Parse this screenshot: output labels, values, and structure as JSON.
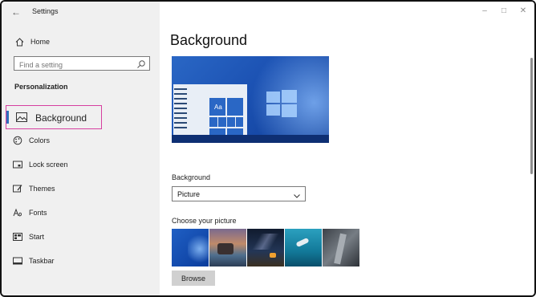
{
  "window": {
    "title": "Settings",
    "controls": [
      "minimize",
      "maximize",
      "close"
    ]
  },
  "sidebar": {
    "home_label": "Home",
    "search": {
      "placeholder": "Find a setting",
      "icon": "search-icon"
    },
    "section_title": "Personalization",
    "items": [
      {
        "label": "Background",
        "icon": "image-icon",
        "active": true
      },
      {
        "label": "Colors",
        "icon": "palette-icon"
      },
      {
        "label": "Lock screen",
        "icon": "lock-screen-icon"
      },
      {
        "label": "Themes",
        "icon": "themes-icon"
      },
      {
        "label": "Fonts",
        "icon": "fonts-icon"
      },
      {
        "label": "Start",
        "icon": "start-icon"
      },
      {
        "label": "Taskbar",
        "icon": "taskbar-icon"
      }
    ],
    "accent_color": "#2f6fbd",
    "highlight_color": "#d63fa0"
  },
  "main": {
    "title": "Background",
    "preview_sample_text": "Aa",
    "background_label": "Background",
    "background_select": {
      "value": "Picture"
    },
    "choose_label": "Choose your picture",
    "pictures": [
      {
        "name": "windows-blue"
      },
      {
        "name": "beach-rocks"
      },
      {
        "name": "night-sky-tent"
      },
      {
        "name": "underwater-swimmer"
      },
      {
        "name": "rock-cliff"
      }
    ],
    "browse_label": "Browse"
  }
}
